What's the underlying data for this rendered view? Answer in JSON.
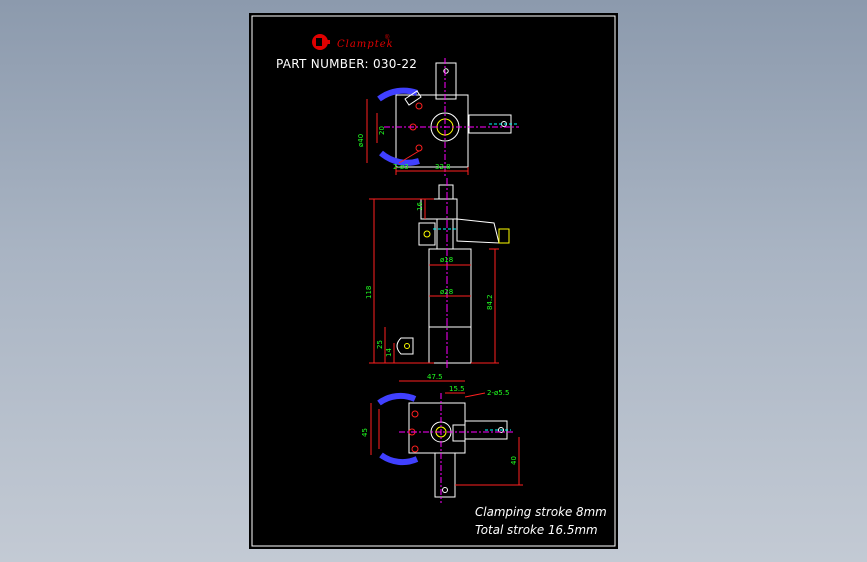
{
  "brand": {
    "name": "Clamptek",
    "reg_mark": "®",
    "color": "#e00000"
  },
  "part_number": {
    "text": "PART NUMBER: 030-22"
  },
  "notes": {
    "clamping_stroke": "Clamping stroke 8mm",
    "total_stroke": "Total stroke 16.5mm"
  },
  "colors": {
    "sheet": "#000000",
    "outline": "#ffffff",
    "dimension": "#ff2020",
    "dim_text": "#20ff20",
    "centerline": "#ff00ff",
    "hatch": "#4040ff",
    "detail": "#ffff00",
    "hidden": "#00ffff"
  },
  "dims": {
    "top": {
      "d40": "ø40",
      "d20": "20",
      "d3": "2-ø3",
      "w32": "32.8"
    },
    "mid": {
      "h16": "16",
      "h118": "118",
      "d18": "ø18",
      "d28": "ø28",
      "h84": "84.2",
      "h25": "25",
      "h14": "14"
    },
    "bot": {
      "w47": "47.5",
      "w15": "15.5",
      "holes": "2-ø5.5",
      "h45": "45",
      "h40": "40"
    }
  }
}
